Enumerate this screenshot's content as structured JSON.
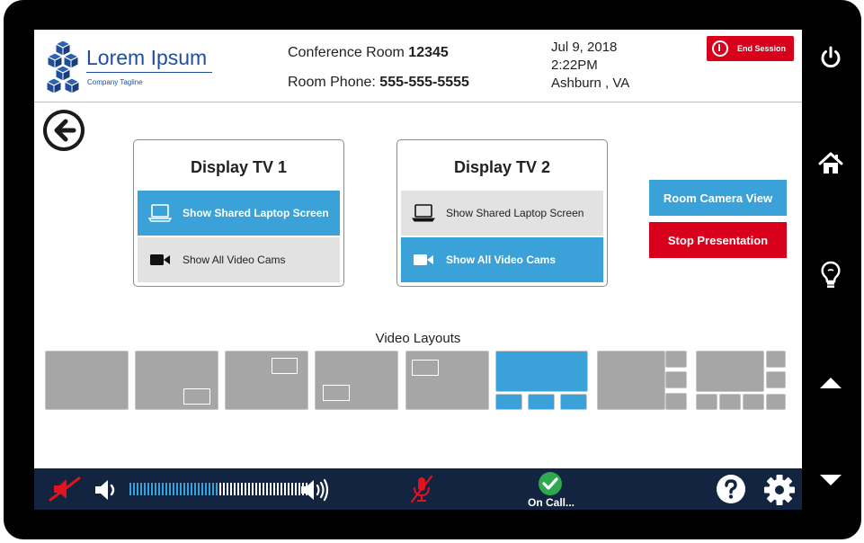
{
  "company": {
    "name": "Lorem Ipsum",
    "tagline": "Company Tagline"
  },
  "room": {
    "conference_label": "Conference Room",
    "conference_number": "12345",
    "phone_label": "Room Phone:",
    "phone_number": "555-555-5555"
  },
  "datetime": {
    "date": "Jul 9, 2018",
    "time": "2:22PM",
    "location": "Ashburn , VA"
  },
  "end_session_label": "End Session",
  "displays": [
    {
      "title": "Display TV 1",
      "sources": [
        {
          "label": "Show Shared Laptop Screen",
          "icon": "laptop-icon",
          "active": true
        },
        {
          "label": "Show All Video Cams",
          "icon": "video-camera-icon",
          "active": false
        }
      ]
    },
    {
      "title": "Display TV 2",
      "sources": [
        {
          "label": "Show Shared Laptop Screen",
          "icon": "laptop-icon",
          "active": false
        },
        {
          "label": "Show All Video Cams",
          "icon": "video-camera-icon",
          "active": true
        }
      ]
    }
  ],
  "actions": {
    "room_camera_view": "Room Camera View",
    "stop_presentation": "Stop Presentation"
  },
  "video_layouts": {
    "title": "Video Layouts",
    "selected_index": 5,
    "count": 8
  },
  "bottom_bar": {
    "speaker_muted": true,
    "microphone_muted": true,
    "volume_level": 0.5,
    "call_status": "On Call..."
  },
  "rail_icons": [
    "power-icon",
    "home-icon",
    "lightbulb-icon",
    "arrow-up-icon",
    "arrow-down-icon"
  ],
  "colors": {
    "accent_blue": "#3aa2d8",
    "alert_red": "#d9001b",
    "brand_blue": "#1f4f9c",
    "bar_navy": "#12243f",
    "status_green": "#2fa84f"
  }
}
